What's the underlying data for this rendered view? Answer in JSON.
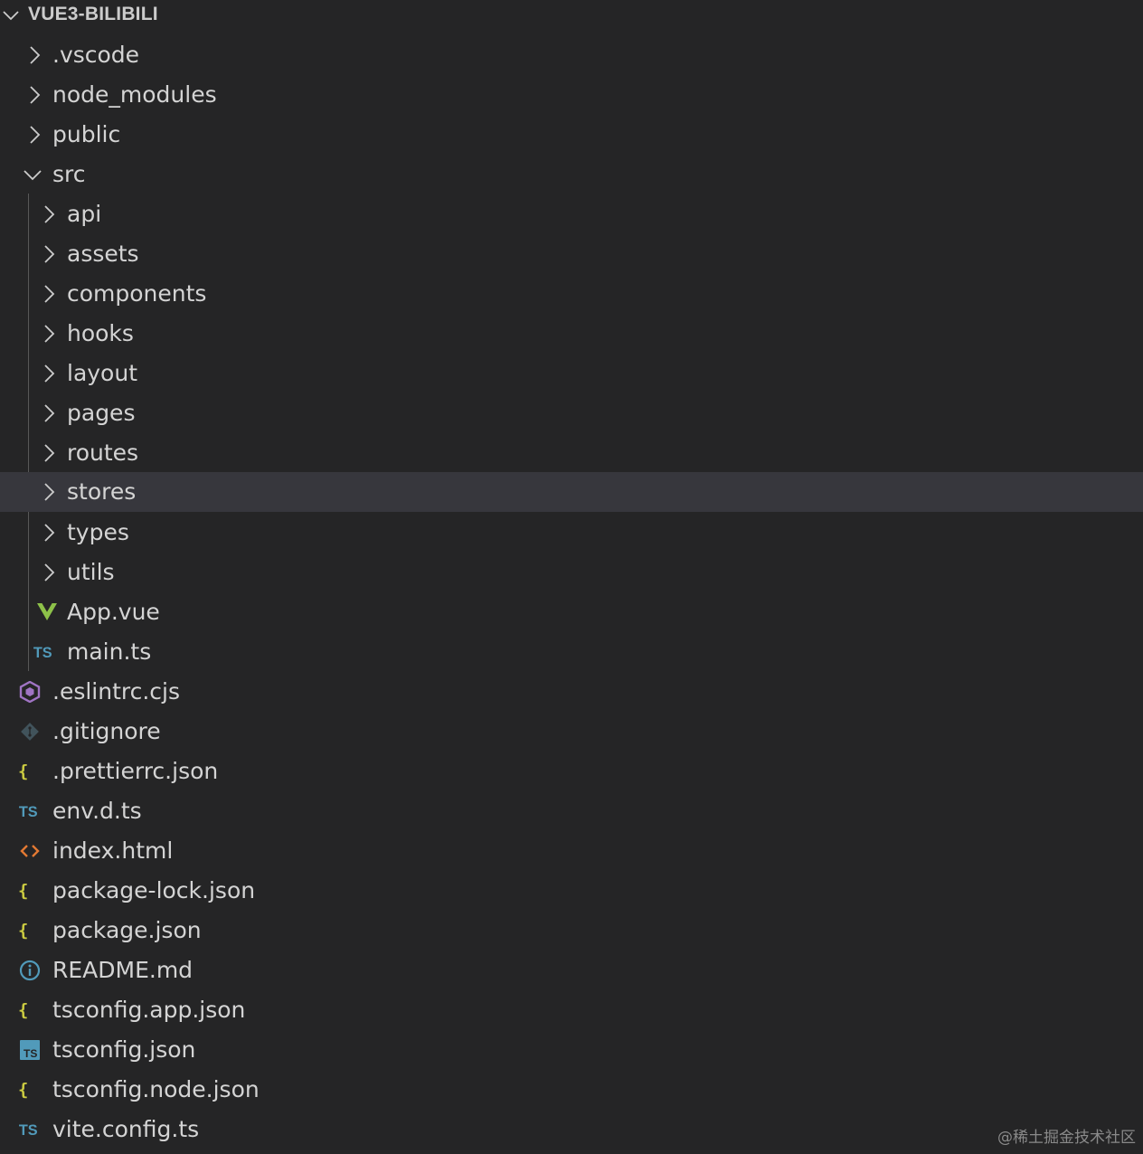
{
  "explorer": {
    "root_label": "VUE3-BILIBILI",
    "items": [
      {
        "label": ".vscode",
        "kind": "folder",
        "expanded": false,
        "icon": "chevron-right-icon"
      },
      {
        "label": "node_modules",
        "kind": "folder",
        "expanded": false,
        "icon": "chevron-right-icon"
      },
      {
        "label": "public",
        "kind": "folder",
        "expanded": false,
        "icon": "chevron-right-icon"
      },
      {
        "label": "src",
        "kind": "folder",
        "expanded": true,
        "icon": "chevron-down-icon"
      },
      {
        "label": "api",
        "kind": "folder",
        "expanded": false,
        "icon": "chevron-right-icon"
      },
      {
        "label": "assets",
        "kind": "folder",
        "expanded": false,
        "icon": "chevron-right-icon"
      },
      {
        "label": "components",
        "kind": "folder",
        "expanded": false,
        "icon": "chevron-right-icon"
      },
      {
        "label": "hooks",
        "kind": "folder",
        "expanded": false,
        "icon": "chevron-right-icon"
      },
      {
        "label": "layout",
        "kind": "folder",
        "expanded": false,
        "icon": "chevron-right-icon"
      },
      {
        "label": "pages",
        "kind": "folder",
        "expanded": false,
        "icon": "chevron-right-icon"
      },
      {
        "label": "routes",
        "kind": "folder",
        "expanded": false,
        "icon": "chevron-right-icon"
      },
      {
        "label": "stores",
        "kind": "folder",
        "expanded": false,
        "icon": "chevron-right-icon",
        "selected": true
      },
      {
        "label": "types",
        "kind": "folder",
        "expanded": false,
        "icon": "chevron-right-icon"
      },
      {
        "label": "utils",
        "kind": "folder",
        "expanded": false,
        "icon": "chevron-right-icon"
      },
      {
        "label": "App.vue",
        "kind": "file",
        "icon": "vue-icon"
      },
      {
        "label": "main.ts",
        "kind": "file",
        "icon": "typescript-icon"
      },
      {
        "label": ".eslintrc.cjs",
        "kind": "file",
        "icon": "eslint-icon"
      },
      {
        "label": ".gitignore",
        "kind": "file",
        "icon": "git-icon"
      },
      {
        "label": ".prettierrc.json",
        "kind": "file",
        "icon": "json-icon"
      },
      {
        "label": "env.d.ts",
        "kind": "file",
        "icon": "typescript-icon"
      },
      {
        "label": "index.html",
        "kind": "file",
        "icon": "html-icon"
      },
      {
        "label": "package-lock.json",
        "kind": "file",
        "icon": "json-icon"
      },
      {
        "label": "package.json",
        "kind": "file",
        "icon": "json-icon"
      },
      {
        "label": "README.md",
        "kind": "file",
        "icon": "info-icon"
      },
      {
        "label": "tsconfig.app.json",
        "kind": "file",
        "icon": "json-icon"
      },
      {
        "label": "tsconfig.json",
        "kind": "file",
        "icon": "tsconfig-icon"
      },
      {
        "label": "tsconfig.node.json",
        "kind": "file",
        "icon": "json-icon"
      },
      {
        "label": "vite.config.ts",
        "kind": "file",
        "icon": "typescript-icon"
      }
    ],
    "icon_text": {
      "typescript": "TS",
      "json": "{ }"
    },
    "colors": {
      "background": "#252526",
      "selected_row": "#37373d",
      "text": "#d4d4d4",
      "vue": "#8dc149",
      "typescript": "#519aba",
      "json": "#cbcb41",
      "html": "#e37933",
      "eslint": "#a074c4",
      "git": "#41535b"
    }
  },
  "watermark": "@稀土掘金技术社区"
}
